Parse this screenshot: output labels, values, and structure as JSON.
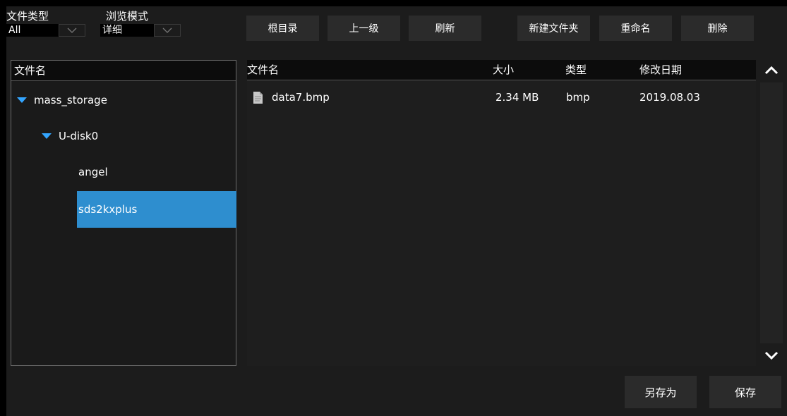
{
  "toolbar": {
    "file_type_label": "文件类型",
    "file_type_value": "All",
    "browse_mode_label": "浏览模式",
    "browse_mode_value": "详细",
    "buttons": [
      "根目录",
      "上一级",
      "刷新",
      "新建文件夹",
      "重命名",
      "删除"
    ]
  },
  "tree": {
    "header": "文件名",
    "items": [
      "mass_storage",
      "U-disk0",
      "angel",
      "sds2kxplus"
    ],
    "selected": "sds2kxplus",
    "accent": "#2e8ecf"
  },
  "files": {
    "columns": [
      "文件名",
      "大小",
      "类型",
      "修改日期"
    ],
    "rows": [
      {
        "name": "data7.bmp",
        "size": "2.34 MB",
        "type": "bmp",
        "date": "2019.08.03"
      }
    ]
  },
  "footer": {
    "save_as": "另存为",
    "save": "保存"
  },
  "icons": [
    "chevron-down-icon",
    "triangle-down-icon",
    "file-icon",
    "chevron-up-icon"
  ]
}
